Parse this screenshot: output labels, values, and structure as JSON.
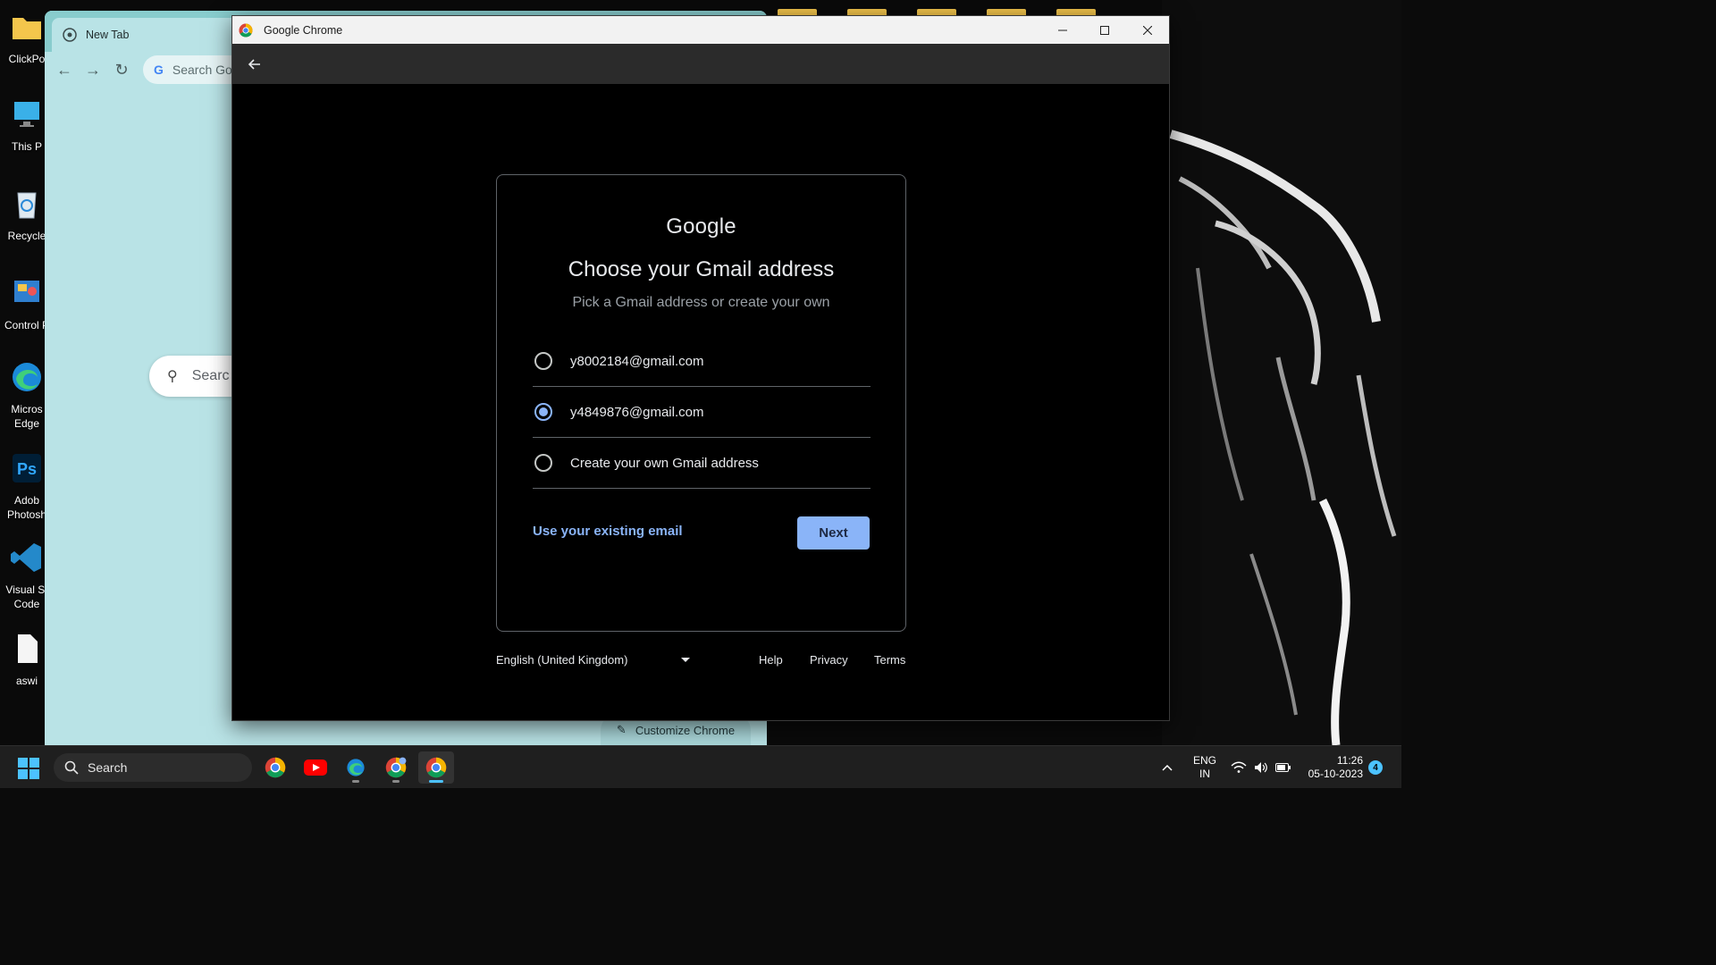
{
  "desktop": {
    "icons": [
      {
        "label": "ClickPo",
        "icon": "folder-icon"
      },
      {
        "label": "This P",
        "icon": "computer-icon"
      },
      {
        "label": "Recycle",
        "icon": "recycle-bin-icon"
      },
      {
        "label": "Control P",
        "icon": "control-panel-icon"
      },
      {
        "label": "Micros",
        "label2": "Edge",
        "icon": "edge-icon"
      },
      {
        "label": "Adob",
        "label2": "Photosh",
        "icon": "photoshop-icon"
      },
      {
        "label": "Visual St",
        "label2": "Code",
        "icon": "vscode-icon"
      },
      {
        "label": "aswi",
        "icon": "file-icon"
      }
    ]
  },
  "background_window": {
    "tab_title": "New Tab",
    "omnibox_placeholder": "Search Go",
    "search_placeholder": "Searc",
    "customize_label": "Customize Chrome"
  },
  "main_window": {
    "title": "Google Chrome",
    "card": {
      "brand": "Google",
      "heading": "Choose your Gmail address",
      "subheading": "Pick a Gmail address or create your own",
      "options": [
        {
          "label": "y8002184@gmail.com",
          "selected": false
        },
        {
          "label": "y4849876@gmail.com",
          "selected": true
        },
        {
          "label": "Create your own Gmail address",
          "selected": false
        }
      ],
      "use_existing_label": "Use your existing email",
      "next_label": "Next"
    },
    "footer": {
      "language": "English (United Kingdom)",
      "help": "Help",
      "privacy": "Privacy",
      "terms": "Terms"
    }
  },
  "taskbar": {
    "search_label": "Search",
    "apps": [
      "chrome-icon",
      "youtube-icon",
      "edge-icon",
      "chrome-profile-icon",
      "chrome-icon"
    ],
    "tray": {
      "lang_line1": "ENG",
      "lang_line2": "IN",
      "time": "11:26",
      "date": "05-10-2023",
      "notifications": "4"
    }
  },
  "colors": {
    "accent_blue": "#8ab4f8",
    "card_border": "#5f6368",
    "text_primary": "#e8eaed",
    "text_secondary": "#9aa0a6",
    "bg_window_teal": "#b9e3e6"
  }
}
